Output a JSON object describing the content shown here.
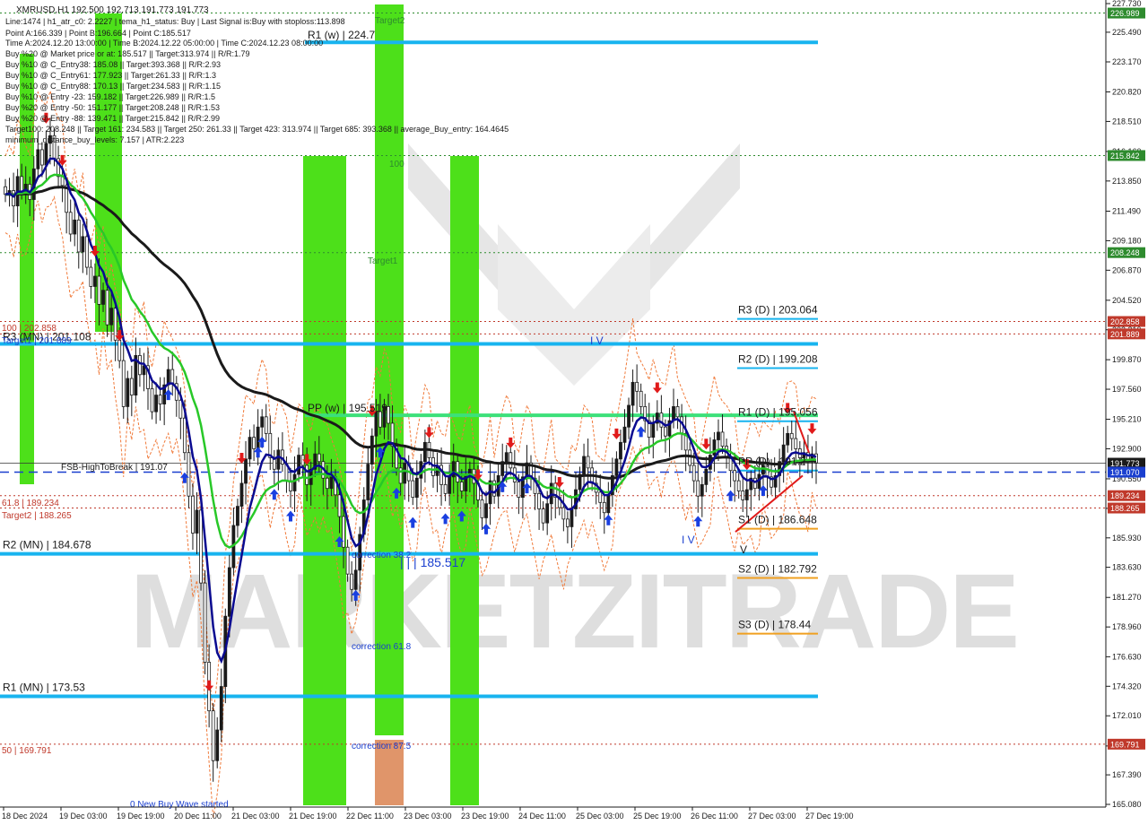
{
  "chart_data": {
    "type": "candlestick",
    "symbol_line": "XMRUSD,H1  192.500 192.713 191.773 191.773",
    "info_lines": [
      "Line:1474 | h1_atr_c0: 2.2227 | tema_h1_status: Buy | Last Signal is:Buy with stoploss:113.898",
      "Point A:166.339 | Point B:196.664 | Point C:185.517",
      "Time A:2024.12.20 13:00:00 | Time B:2024.12.22 05:00:00 | Time C:2024.12.23 08:00:00",
      "Buy %20 @ Market price or at: 185.517 || Target:313.974 || R/R:1.79",
      "Buy %10 @ C_Entry38: 185.08 || Target:393.368 || R/R:2.93",
      "Buy %10 @ C_Entry61: 177.923 || Target:261.33 || R/R:1.3",
      "Buy %10 @ C_Entry88: 170.13 || Target:234.583 || R/R:1.15",
      "Buy %10 @ Entry -23: 159.182 || Target:226.989 || R/R:1.5",
      "Buy %20 @ Entry -50: 151.177 || Target:208.248 || R/R:1.53",
      "Buy %20 @ Entry -88: 139.471 || Target:215.842 || R/R:2.99",
      "Target100: 208.248 || Target 161: 234.583 || Target 250: 261.33 || Target 423: 313.974 || Target 685: 393.368 || average_Buy_entry: 164.4645",
      "minimum_distance_buy_levels: 7.157 | ATR:2.223"
    ],
    "watermark": "MARKETZITRADE",
    "y_axis": {
      "min": 165.08,
      "max": 227.73,
      "ticks": [
        227.73,
        225.49,
        223.17,
        220.82,
        218.51,
        216.16,
        213.85,
        211.49,
        209.18,
        206.87,
        204.52,
        202.21,
        199.87,
        197.56,
        195.21,
        192.9,
        190.55,
        188.24,
        185.93,
        183.63,
        181.27,
        178.96,
        176.63,
        174.32,
        172.01,
        169.65,
        167.39,
        165.08
      ]
    },
    "x_axis": {
      "labels": [
        "18 Dec 2024",
        "19 Dec 03:00",
        "19 Dec 19:00",
        "20 Dec 11:00",
        "21 Dec 03:00",
        "21 Dec 19:00",
        "22 Dec 11:00",
        "23 Dec 03:00",
        "23 Dec 19:00",
        "24 Dec 11:00",
        "25 Dec 03:00",
        "25 Dec 19:00",
        "26 Dec 11:00",
        "27 Dec 03:00",
        "27 Dec 19:00"
      ]
    },
    "price_badges": [
      {
        "label": "226.989",
        "value": 226.989,
        "color": "#2e8b2e"
      },
      {
        "label": "215.842",
        "value": 215.842,
        "color": "#2e8b2e"
      },
      {
        "label": "208.248",
        "value": 208.248,
        "color": "#2e8b2e"
      },
      {
        "label": "202.858",
        "value": 202.858,
        "color": "#c0392b"
      },
      {
        "label": "201.889",
        "value": 201.889,
        "color": "#c0392b"
      },
      {
        "label": "191.773",
        "value": 191.773,
        "color": "#1a1a1a"
      },
      {
        "label": "191.070",
        "value": 191.07,
        "color": "#1a3fcf"
      },
      {
        "label": "189.234",
        "value": 189.234,
        "color": "#c0392b"
      },
      {
        "label": "188.265",
        "value": 188.265,
        "color": "#c0392b"
      },
      {
        "label": "169.791",
        "value": 169.791,
        "color": "#c0392b"
      }
    ],
    "levels": [
      {
        "label": "R1 (w) | 224.7",
        "value": 224.7
      },
      {
        "label": "R3 (MN) | 201.108",
        "value": 201.108
      },
      {
        "label": "PP (w) | 195.519",
        "value": 195.519
      },
      {
        "label": "R2 (MN) | 184.678",
        "value": 184.678
      },
      {
        "label": "R1 (MN) | 173.53",
        "value": 173.53
      },
      {
        "label": "R3 (D) | 203.064",
        "value": 203.064
      },
      {
        "label": "R2 (D) | 199.208",
        "value": 199.208
      },
      {
        "label": "R1 (D) | 195.056",
        "value": 195.056
      },
      {
        "label": "PP (D) | 191.2",
        "value": 191.2
      },
      {
        "label": "S1 (D) | 186.648",
        "value": 186.648
      },
      {
        "label": "S2 (D) | 182.792",
        "value": 182.792
      },
      {
        "label": "S3 (D) | 178.44",
        "value": 178.44
      }
    ],
    "annotations": [
      {
        "text": "Target2",
        "color": "#2e8b2e"
      },
      {
        "text": "Target1",
        "color": "#2e8b2e"
      },
      {
        "text": "100",
        "color": "#2e8b2e"
      },
      {
        "text": "FSB-HighToBreak | 191.07",
        "color": "#1a1a1a"
      },
      {
        "text": "100 | 202.858",
        "color": "#c0392b"
      },
      {
        "text": "Target1 | 201.889",
        "color": "#1a3fcf"
      },
      {
        "text": "61.8 | 189.234",
        "color": "#c0392b"
      },
      {
        "text": "Target2 | 188.265",
        "color": "#c0392b"
      },
      {
        "text": "50 | 169.791",
        "color": "#c0392b"
      },
      {
        "text": "| | | 185.517",
        "color": "#1a3fcf"
      },
      {
        "text": "correction 38.2",
        "color": "#1a3fcf"
      },
      {
        "text": "correction 61.8",
        "color": "#1a3fcf"
      },
      {
        "text": "correction 87.5",
        "color": "#1a3fcf"
      },
      {
        "text": "0 New Buy Wave started",
        "color": "#1a3fcf"
      },
      {
        "text": "V",
        "color": "#1a1a1a"
      },
      {
        "text": "I V",
        "color": "#1a3fcf"
      },
      {
        "text": "I V",
        "color": "#1a3fcf"
      }
    ],
    "series": {
      "close": [
        212.8,
        213.1,
        211.9,
        214.2,
        213.0,
        213.6,
        212.4,
        214.8,
        216.3,
        215.1,
        216.8,
        217.4,
        215.6,
        214.2,
        213.5,
        211.4,
        209.7,
        210.8,
        208.3,
        209.5,
        207.1,
        205.6,
        206.4,
        204.2,
        205.3,
        202.6,
        203.9,
        201.4,
        199.8,
        196.2,
        198.4,
        197.1,
        200.2,
        198.7,
        199.4,
        197.6,
        195.8,
        197.1,
        196.4,
        197.9,
        199.1,
        198.0,
        196.7,
        195.3,
        192.6,
        189.2,
        186.3,
        188.1,
        182.4,
        176.2,
        172.4,
        168.5,
        170.9,
        174.3,
        179.8,
        183.6,
        186.9,
        188.4,
        190.2,
        192.1,
        193.8,
        192.9,
        194.6,
        195.4,
        194.1,
        192.2,
        191.3,
        192.8,
        191.7,
        190.4,
        189.6,
        190.9,
        192.4,
        191.6,
        190.1,
        191.3,
        192.5,
        191.9,
        190.6,
        189.8,
        190.7,
        189.3,
        187.6,
        185.2,
        183.1,
        181.9,
        183.4,
        186.2,
        188.9,
        191.7,
        193.9,
        195.8,
        194.6,
        196.2,
        194.9,
        193.1,
        191.4,
        190.2,
        191.8,
        190.4,
        189.1,
        190.6,
        191.9,
        193.4,
        192.2,
        190.8,
        191.6,
        190.1,
        189.4,
        190.7,
        191.9,
        190.3,
        189.6,
        190.8,
        191.3,
        190.2,
        188.9,
        187.5,
        188.6,
        190.4,
        189.2,
        190.8,
        191.9,
        192.6,
        191.4,
        190.3,
        189.1,
        190.7,
        191.8,
        190.6,
        189.4,
        188.2,
        187.1,
        188.6,
        190.2,
        189.1,
        188.3,
        187.4,
        186.8,
        188.2,
        189.7,
        190.9,
        192.3,
        191.4,
        190.2,
        189.5,
        188.7,
        187.9,
        189.3,
        190.8,
        192.1,
        193.4,
        194.6,
        196.3,
        198.1,
        197.4,
        196.2,
        195.1,
        193.8,
        194.9,
        195.7,
        194.6,
        193.9,
        195.1,
        196.2,
        195.4,
        194.1,
        192.8,
        191.6,
        190.4,
        189.2,
        190.1,
        191.3,
        192.4,
        193.6,
        194.2,
        193.1,
        192.3,
        191.2,
        190.4,
        189.6,
        188.9,
        189.7,
        190.6,
        189.8,
        190.9,
        191.6,
        190.7,
        189.9,
        190.8,
        191.9,
        193.2,
        194.1,
        193.7,
        192.9,
        192.2,
        192.6,
        191.9,
        192.5,
        191.8
      ]
    }
  }
}
